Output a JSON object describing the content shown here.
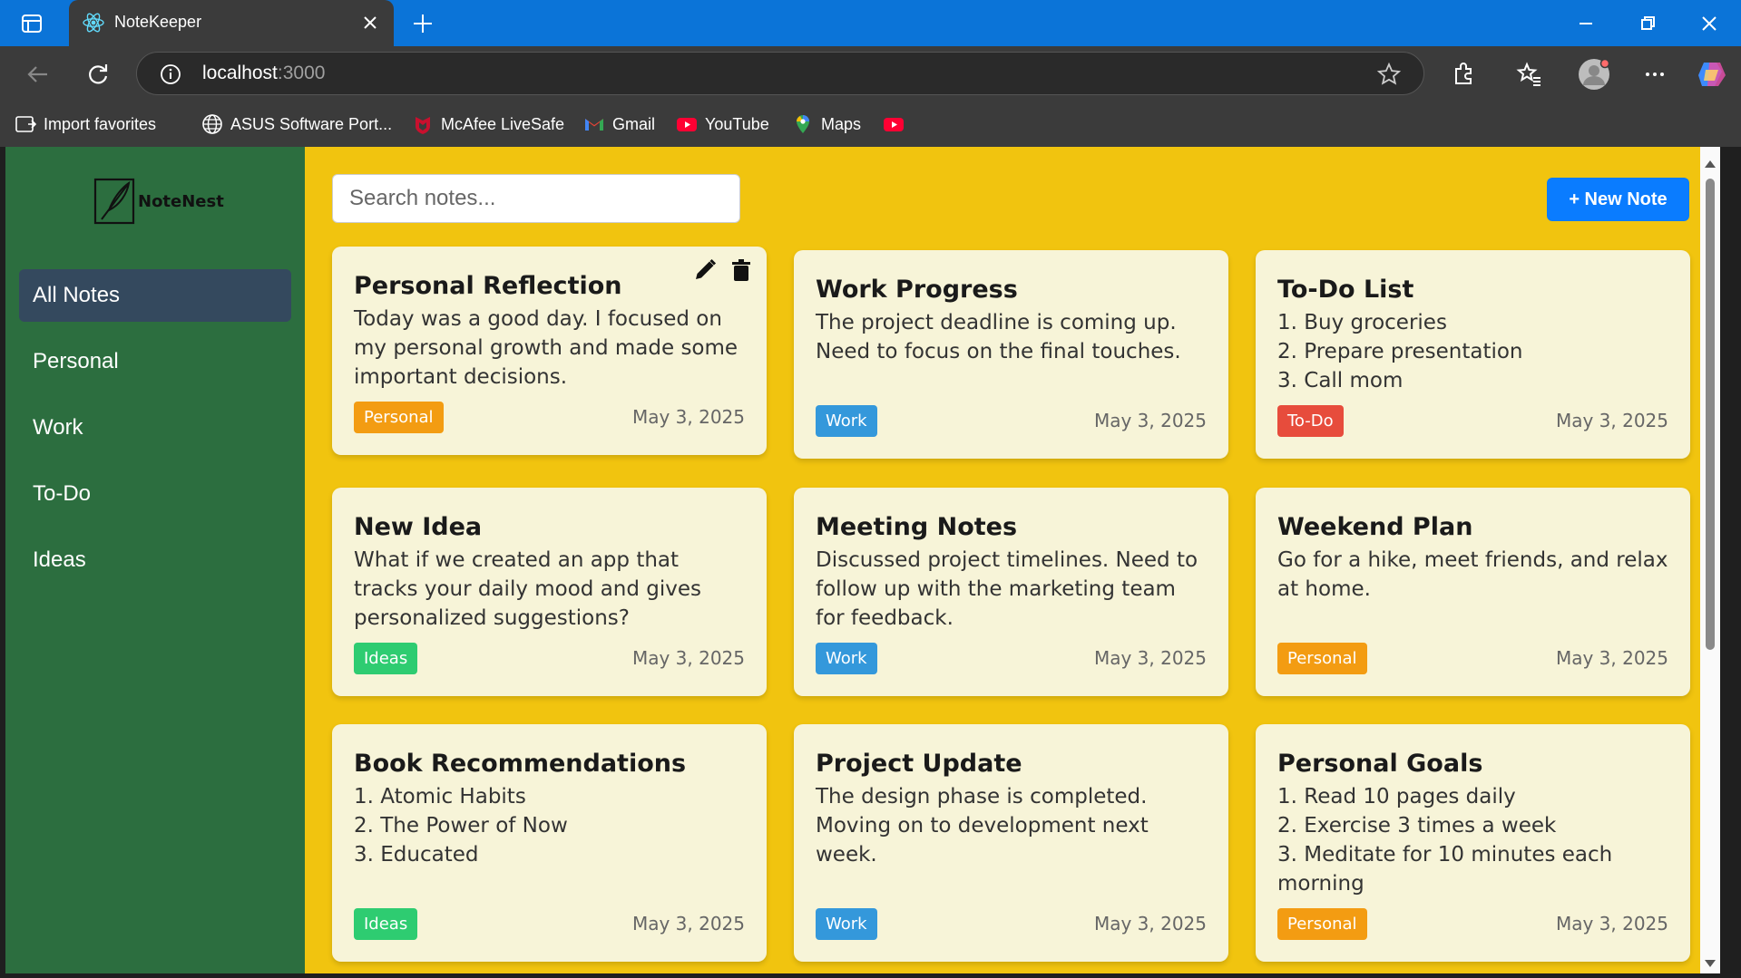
{
  "browser": {
    "tab_title": "NoteKeeper",
    "url_host": "localhost",
    "url_port": ":3000",
    "bookmarks": [
      {
        "label": "Import favorites",
        "icon": "import-favorites-icon"
      },
      {
        "label": "ASUS Software Port...",
        "icon": "globe-icon"
      },
      {
        "label": "McAfee LiveSafe",
        "icon": "mcafee-icon"
      },
      {
        "label": "Gmail",
        "icon": "gmail-icon"
      },
      {
        "label": "YouTube",
        "icon": "youtube-icon"
      },
      {
        "label": "Maps",
        "icon": "maps-icon"
      }
    ]
  },
  "app": {
    "logo_text": "NoteNest",
    "search_placeholder": "Search notes...",
    "new_note_label": "+ New Note",
    "nav": [
      {
        "label": "All Notes",
        "active": true
      },
      {
        "label": "Personal"
      },
      {
        "label": "Work"
      },
      {
        "label": "To-Do"
      },
      {
        "label": "Ideas"
      }
    ],
    "colors": {
      "sidebar": "#2c6e3f",
      "background": "#f1c40f",
      "active_nav": "#34495e",
      "primary_button": "#0a7cff",
      "tag_personal": "#f39c12",
      "tag_work": "#3498db",
      "tag_todo": "#e74c3c",
      "tag_ideas": "#2ecc71"
    },
    "notes": [
      {
        "title": "Personal Reflection",
        "body": "Today was a good day. I focused on my personal growth and made some important decisions.",
        "tag": "Personal",
        "date": "May 3, 2025"
      },
      {
        "title": "Work Progress",
        "body": "The project deadline is coming up. Need to focus on the final touches.",
        "tag": "Work",
        "date": "May 3, 2025"
      },
      {
        "title": "To-Do List",
        "body": "1. Buy groceries\n2. Prepare presentation\n3. Call mom",
        "tag": "To-Do",
        "date": "May 3, 2025"
      },
      {
        "title": "New Idea",
        "body": "What if we created an app that tracks your daily mood and gives personalized suggestions?",
        "tag": "Ideas",
        "date": "May 3, 2025"
      },
      {
        "title": "Meeting Notes",
        "body": "Discussed project timelines. Need to follow up with the marketing team for feedback.",
        "tag": "Work",
        "date": "May 3, 2025"
      },
      {
        "title": "Weekend Plan",
        "body": "Go for a hike, meet friends, and relax at home.",
        "tag": "Personal",
        "date": "May 3, 2025"
      },
      {
        "title": "Book Recommendations",
        "body": "1. Atomic Habits\n2. The Power of Now\n3. Educated",
        "tag": "Ideas",
        "date": "May 3, 2025"
      },
      {
        "title": "Project Update",
        "body": "The design phase is completed. Moving on to development next week.",
        "tag": "Work",
        "date": "May 3, 2025"
      },
      {
        "title": "Personal Goals",
        "body": "1. Read 10 pages daily\n2. Exercise 3 times a week\n3. Meditate for 10 minutes each morning",
        "tag": "Personal",
        "date": "May 3, 2025"
      }
    ]
  }
}
